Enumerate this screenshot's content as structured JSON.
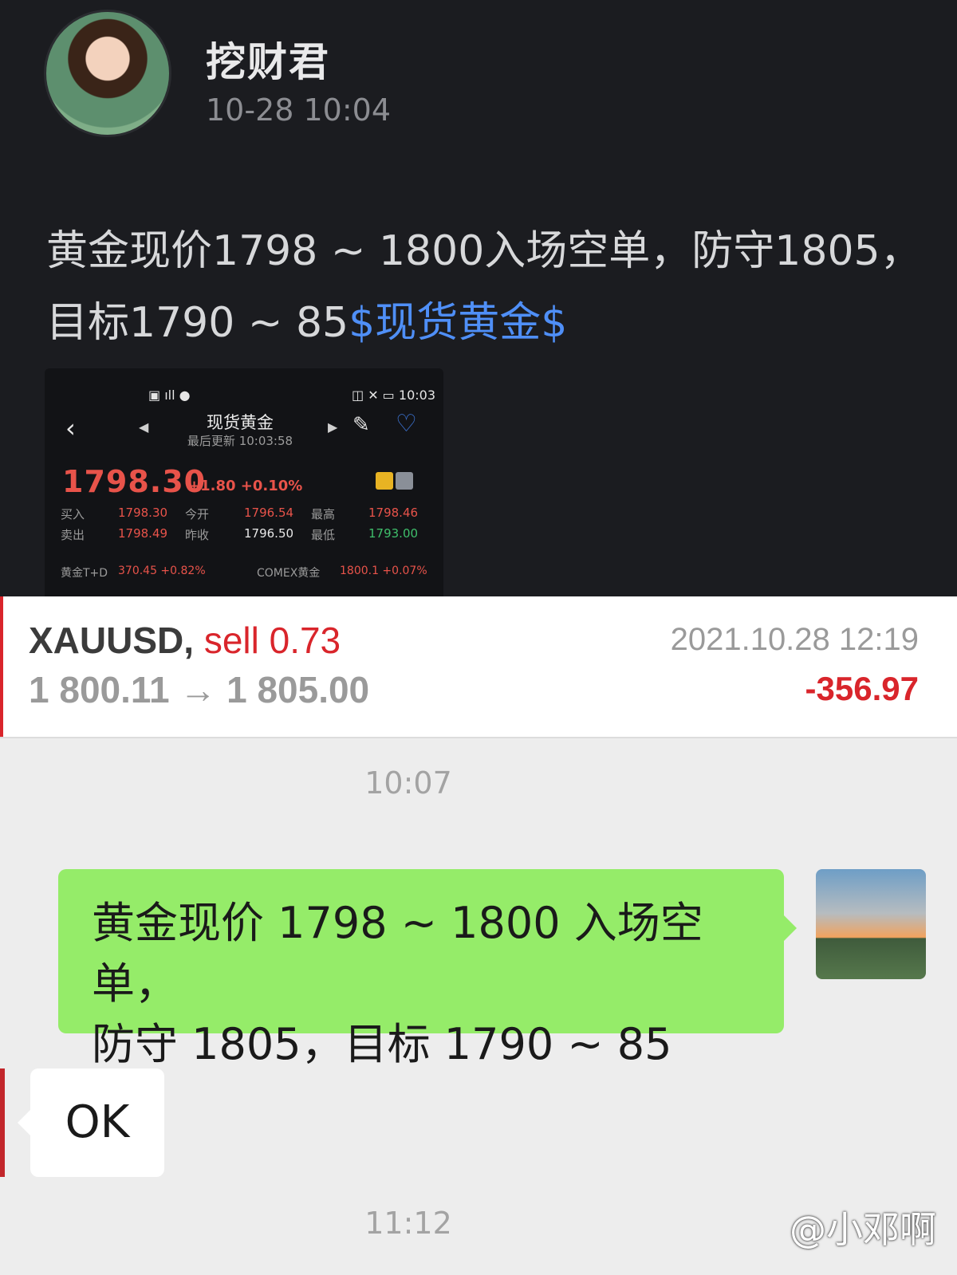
{
  "post": {
    "author": "挖财君",
    "time": "10-28 10:04",
    "text": "黄金现价1798 ~ 1800入场空单，防守1805，目标1790 ~ 85",
    "link": "$现货黄金$"
  },
  "quote": {
    "status_time": "10:03",
    "title": "现货黄金",
    "last_updated_label": "最后更新",
    "last_updated": "10:03:58",
    "price": "1798.30",
    "change": "+1.80 +0.10%",
    "rows": [
      {
        "l1": "买入",
        "v1": "1798.30",
        "l2": "今开",
        "v2": "1796.54",
        "l3": "最高",
        "v3": "1798.46"
      },
      {
        "l1": "卖出",
        "v1": "1798.49",
        "l2": "昨收",
        "v2": "1796.50",
        "l3": "最低",
        "v3": "1793.00"
      }
    ],
    "bottom": {
      "left_label": "黄金T+D",
      "left_value": "370.45 +0.82%",
      "right_label": "COMEX黄金",
      "right_value": "1800.1 +0.07%"
    }
  },
  "trade": {
    "symbol": "XAUUSD,",
    "side": "sell 0.73",
    "prices": "1 800.11 → 1 805.00",
    "datetime": "2021.10.28 12:19",
    "profit": "-356.97"
  },
  "chat": {
    "time1": "10:07",
    "message_line1": "黄金现价 1798 ~ 1800 入场空单，",
    "message_line2": "防守 1805，目标 1790 ~ 85",
    "reply": "OK",
    "time2": "11:12"
  },
  "watermark": "@小邓啊"
}
